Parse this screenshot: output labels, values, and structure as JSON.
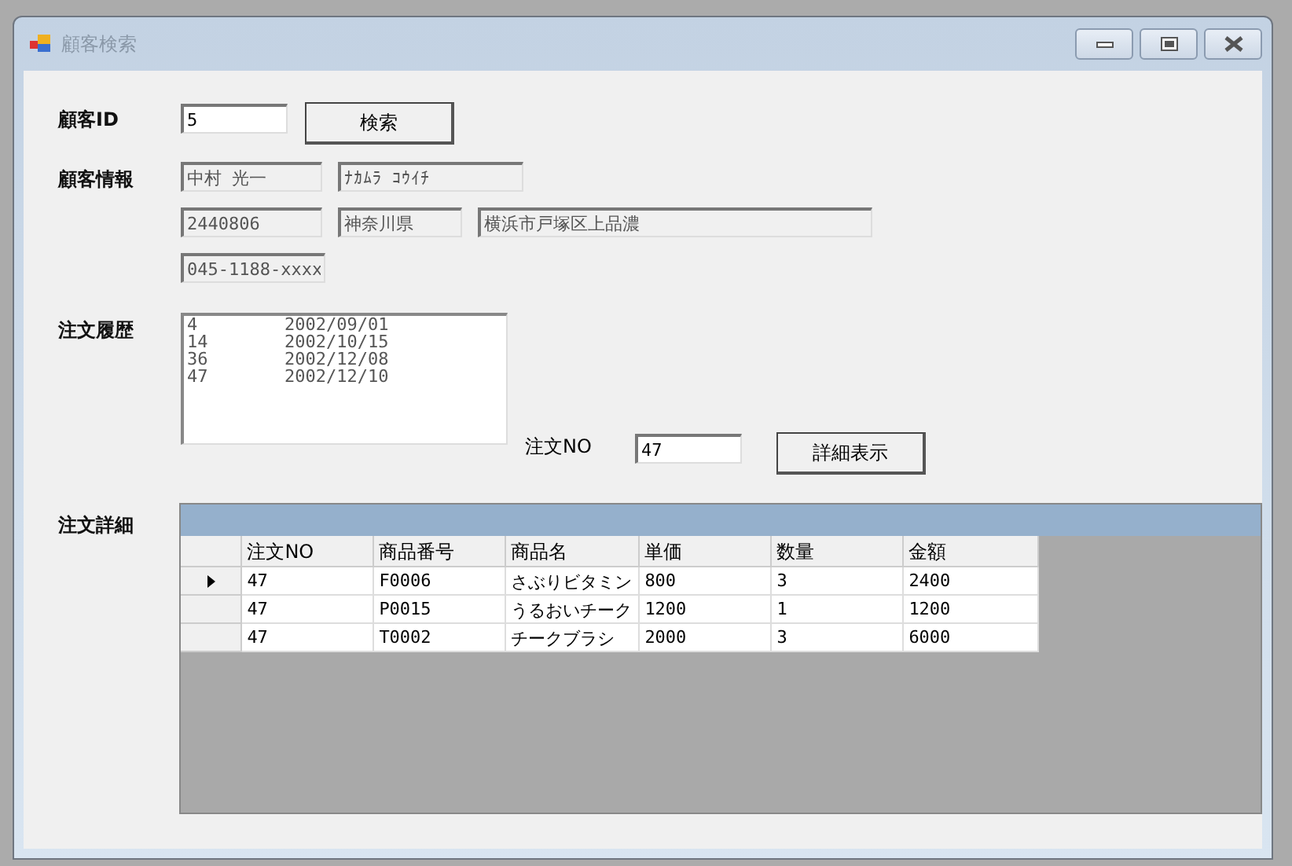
{
  "window": {
    "title": "顧客検索"
  },
  "customer_id": {
    "label": "顧客ID",
    "value": "5",
    "button": "検索"
  },
  "customer_info": {
    "label": "顧客情報",
    "rows": [
      [
        {
          "value": "中村 光一",
          "disabled": true
        },
        {
          "value": "ﾅｶﾑﾗ ｺｳｲﾁ",
          "disabled": true
        }
      ],
      [
        {
          "value": "2440806",
          "disabled": true
        },
        {
          "value": "神奈川県",
          "disabled": true
        },
        {
          "value": "横浜市戸塚区上品濃",
          "disabled": true
        }
      ],
      [
        {
          "value": "045-1188-xxxx",
          "disabled": true
        }
      ]
    ]
  },
  "order_history": {
    "label": "注文履歴",
    "items": [
      {
        "number": "4",
        "date": "2002/09/01",
        "selected": false
      },
      {
        "number": "14",
        "date": "2002/10/15",
        "selected": false
      },
      {
        "number": "36",
        "date": "2002/12/08",
        "selected": false
      },
      {
        "number": "47",
        "date": "2002/12/10",
        "selected": false
      }
    ]
  },
  "order_no": {
    "label": "注文NO",
    "value": "47",
    "button": "詳細表示"
  },
  "order_details": {
    "label": "注文詳細",
    "columns": [
      "注文NO",
      "商品番号",
      "商品名",
      "単価",
      "数量",
      "金額"
    ],
    "rows": [
      {
        "selected": true,
        "cells": [
          "47",
          "F0006",
          "さぶりビタミン",
          "800",
          "3",
          "2400"
        ]
      },
      {
        "selected": false,
        "cells": [
          "47",
          "P0015",
          "うるおいチーク",
          "1200",
          "1",
          "1200"
        ]
      },
      {
        "selected": false,
        "cells": [
          "47",
          "T0002",
          "チークブラシ",
          "2000",
          "3",
          "6000"
        ]
      }
    ]
  }
}
